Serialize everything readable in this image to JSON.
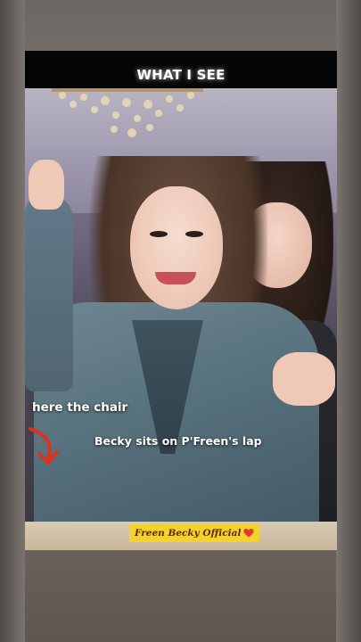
{
  "video": {
    "caption_title": "WHAT I SEE",
    "annotation_chair": "here the chair",
    "annotation_lap": "Becky sits on P'Freen's lap",
    "watermark_text": "Freen Becky Official",
    "watermark_icon": "heart-icon"
  },
  "colors": {
    "caption_bar": "#050505",
    "watermark_bg": "#f4d22b",
    "arrow": "#e0301e",
    "heart": "#e23a2c"
  }
}
